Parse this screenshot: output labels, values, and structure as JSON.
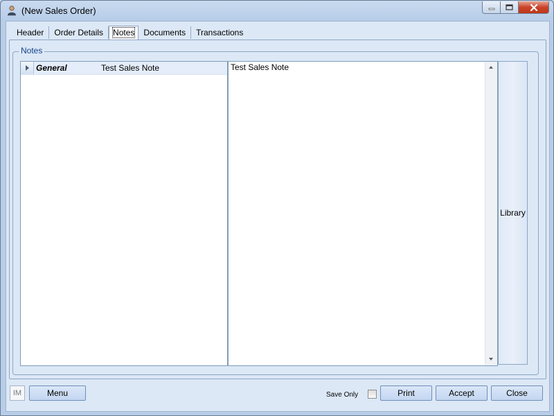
{
  "window": {
    "title": "(New Sales Order)"
  },
  "tabs": [
    {
      "label": "Header",
      "active": false
    },
    {
      "label": "Order Details",
      "active": false
    },
    {
      "label": "Notes",
      "active": true
    },
    {
      "label": "Documents",
      "active": false
    },
    {
      "label": "Transactions",
      "active": false
    }
  ],
  "notes": {
    "group_title": "Notes",
    "rows": [
      {
        "category": "General",
        "summary": "Test Sales Note"
      }
    ],
    "editor_text": "Test Sales Note",
    "library_label": "Library"
  },
  "footer": {
    "im_label": "IM",
    "menu_label": "Menu",
    "save_only_label": "Save Only",
    "save_only_checked": false,
    "print_label": "Print",
    "accept_label": "Accept",
    "close_label": "Close"
  },
  "colors": {
    "window_bg": "#b9d1ea",
    "client_bg": "#dce8f6",
    "group_title": "#15428b",
    "close_button": "#c8432a"
  },
  "icons": {
    "app": "user-icon",
    "minimize": "minimize-icon",
    "maximize": "maximize-icon",
    "close": "close-icon"
  }
}
